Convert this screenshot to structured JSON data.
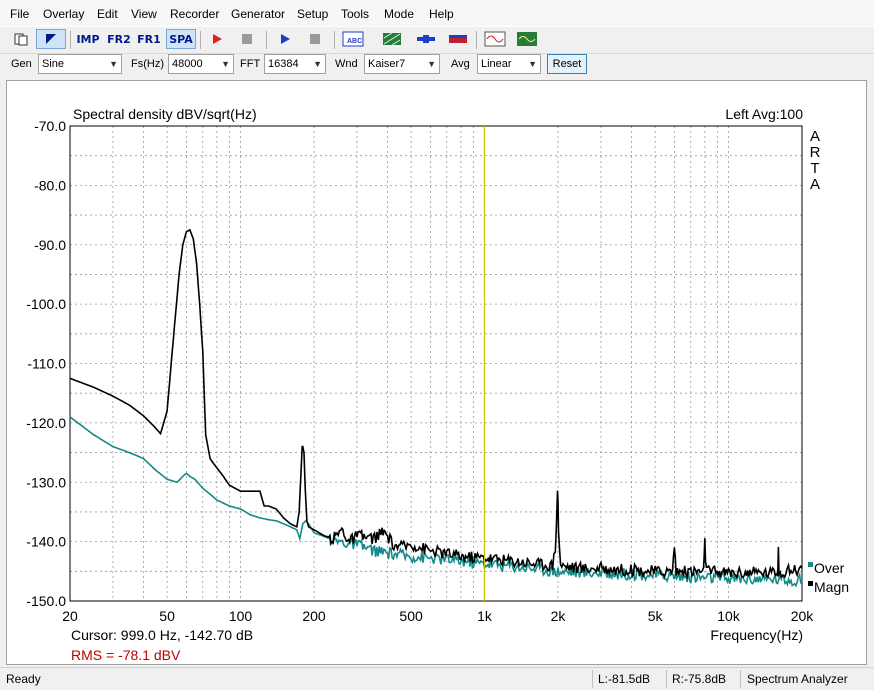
{
  "menu": [
    "File",
    "Overlay",
    "Edit",
    "View",
    "Recorder",
    "Generator",
    "Setup",
    "Tools",
    "Mode",
    "Help"
  ],
  "toolbar": {
    "imp": "IMP",
    "fr2": "FR2",
    "fr1": "FR1",
    "spa": "SPA",
    "icons": [
      "new-doc-icon",
      "pointer-icon",
      "record-icon",
      "stop-icon",
      "play-icon",
      "stop-play-icon",
      "abc-icon",
      "grid-icon",
      "cable-icon",
      "probe-icon",
      "generator-wave-icon",
      "scope-icon"
    ]
  },
  "controls": {
    "gen_label": "Gen",
    "gen_value": "Sine",
    "fs_label": "Fs(Hz)",
    "fs_value": "48000",
    "fft_label": "FFT",
    "fft_value": "16384",
    "wnd_label": "Wnd",
    "wnd_value": "Kaiser7",
    "avg_label": "Avg",
    "avg_value": "Linear",
    "reset_label": "Reset"
  },
  "plot": {
    "title": "Spectral density dBV/sqrt(Hz)",
    "channel_info": "Left  Avg:100",
    "brand": [
      "A",
      "R",
      "T",
      "A"
    ],
    "cursor_text": "Cursor:   999.0 Hz, -142.70 dB",
    "rms_text": "RMS =  -78.1 dBV",
    "xlabel": "Frequency(Hz)",
    "legend_over": "Over",
    "legend_magn": "Magn",
    "colors": {
      "magn": "#000000",
      "over": "#138a8a",
      "cursor": "#c8c800",
      "rms": "#c00000",
      "grid": "#9a9a9a"
    }
  },
  "chart_data": {
    "type": "line",
    "title": "Spectral density dBV/sqrt(Hz)",
    "xlabel": "Frequency(Hz)",
    "ylabel": "",
    "xscale": "log",
    "xlim": [
      20,
      20000
    ],
    "ylim": [
      -150,
      -70
    ],
    "xticks": [
      "20",
      "50",
      "100",
      "200",
      "500",
      "1k",
      "2k",
      "5k",
      "10k",
      "20k"
    ],
    "yticks": [
      "-70.0",
      "-80.0",
      "-90.0",
      "-100.0",
      "-110.0",
      "-120.0",
      "-130.0",
      "-140.0",
      "-150.0"
    ],
    "grid": true,
    "cursor_x": 999,
    "series": [
      {
        "name": "Magn",
        "color": "#000000",
        "x": [
          20,
          25,
          30,
          35,
          40,
          44,
          47,
          50,
          53,
          56,
          58,
          60,
          62,
          64,
          66,
          68,
          70,
          72,
          75,
          78,
          85,
          90,
          100,
          110,
          120,
          125,
          130,
          140,
          150,
          160,
          170,
          174,
          177,
          179,
          180,
          182,
          184,
          187,
          190,
          200,
          220,
          240,
          260,
          280,
          300,
          350,
          380,
          400,
          420,
          450,
          500,
          600,
          700,
          800,
          1000,
          1500,
          1900,
          1950,
          1990,
          2000,
          2010,
          2050,
          2500,
          3000,
          5000,
          5900,
          5950,
          6000,
          6050,
          6100,
          7000,
          7900,
          7950,
          7990,
          8000,
          8010,
          8050,
          8200,
          10000,
          15000,
          15900,
          16000,
          16100,
          17000,
          20000
        ],
        "y": [
          -112.5,
          -114,
          -115.5,
          -117,
          -118.8,
          -120.5,
          -121.8,
          -118,
          -106,
          -95,
          -90,
          -87.8,
          -87.5,
          -89,
          -93,
          -100,
          -108,
          -122,
          -126,
          -127,
          -129,
          -130.5,
          -131.5,
          -131.5,
          -131.5,
          -134,
          -134,
          -134.5,
          -136,
          -137,
          -137.5,
          -135,
          -128,
          -124,
          -124,
          -125,
          -131,
          -136.5,
          -137.5,
          -138,
          -139,
          -139.5,
          -138,
          -140,
          -139,
          -139.5,
          -138.5,
          -139,
          -140.5,
          -141,
          -140.5,
          -141.5,
          -142,
          -142.5,
          -142.7,
          -143.5,
          -144,
          -141,
          -132,
          -132.5,
          -138,
          -144,
          -144.5,
          -144.5,
          -145,
          -145,
          -142,
          -141,
          -143,
          -145,
          -145,
          -145,
          -143,
          -140,
          -139,
          -140,
          -144,
          -145,
          -145.2,
          -145.2,
          -145,
          -141,
          -145,
          -145,
          -144.5
        ]
      },
      {
        "name": "Over",
        "color": "#138a8a",
        "x": [
          20,
          25,
          30,
          35,
          40,
          45,
          50,
          55,
          58,
          60,
          62,
          65,
          70,
          75,
          80,
          90,
          100,
          110,
          120,
          130,
          140,
          150,
          160,
          170,
          175,
          180,
          185,
          190,
          200,
          250,
          300,
          350,
          400,
          500,
          700,
          1000,
          1500,
          2000,
          3000,
          5000,
          7000,
          10000,
          15000,
          20000
        ],
        "y": [
          -119,
          -122,
          -124,
          -125,
          -126,
          -128,
          -129.5,
          -130,
          -129,
          -128.5,
          -129,
          -129.5,
          -131,
          -132,
          -133,
          -134,
          -134.5,
          -135.5,
          -136,
          -136.3,
          -136.5,
          -137,
          -137.5,
          -138,
          -139.5,
          -137,
          -136.5,
          -137,
          -138.5,
          -140,
          -140.5,
          -141.5,
          -142,
          -142.5,
          -143,
          -143.7,
          -144.3,
          -145,
          -145.3,
          -145.6,
          -146,
          -146.2,
          -146.3,
          -146.5
        ]
      }
    ]
  }
}
